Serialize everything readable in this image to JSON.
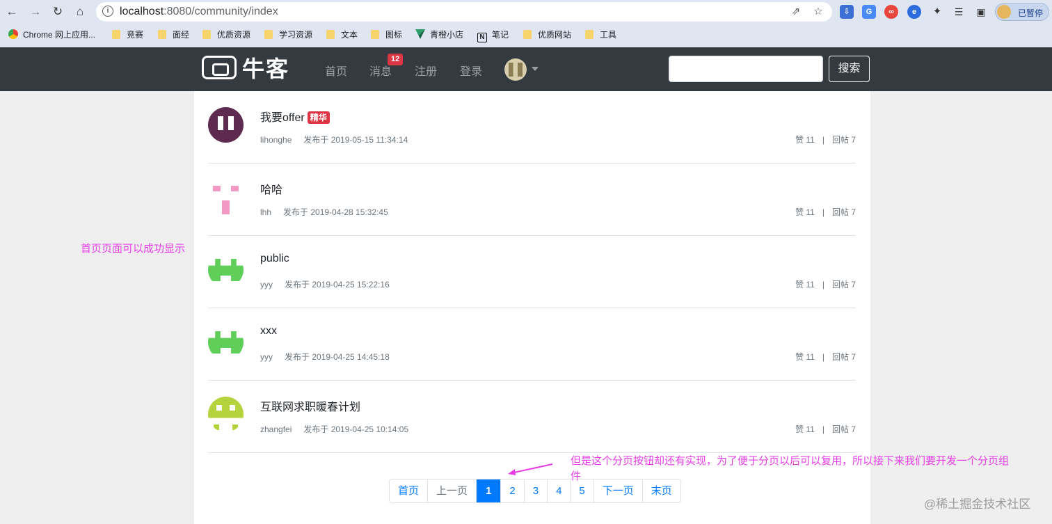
{
  "browser": {
    "url_host": "localhost",
    "url_path": ":8080/community/index",
    "profile_label": "已暂停",
    "bookmarks": [
      {
        "label": "Chrome 网上应用..."
      },
      {
        "label": "竞赛"
      },
      {
        "label": "面经"
      },
      {
        "label": "优质资源"
      },
      {
        "label": "学习资源"
      },
      {
        "label": "文本"
      },
      {
        "label": "图标"
      },
      {
        "label": "青橙小店"
      },
      {
        "label": "笔记"
      },
      {
        "label": "优质网站"
      },
      {
        "label": "工具"
      }
    ]
  },
  "navbar": {
    "logo": "牛客",
    "links": [
      "首页",
      "消息",
      "注册",
      "登录"
    ],
    "message_count": "12",
    "search_button": "搜索",
    "colors": {
      "background": "#343a40",
      "badge": "#dc3545"
    }
  },
  "posts": [
    {
      "title": "我要offer",
      "tag": "精华",
      "author": "lihonghe",
      "time": "发布于 2019-05-15 11:34:14",
      "likes": "赞 11",
      "replies": "回帖 7",
      "avatar_color": "#5e2a4f"
    },
    {
      "title": "哈哈",
      "tag": "",
      "author": "lhh",
      "time": "发布于 2019-04-28 15:32:45",
      "likes": "赞 11",
      "replies": "回帖 7",
      "avatar_color": "#f29ac3"
    },
    {
      "title": "public",
      "tag": "",
      "author": "yyy",
      "time": "发布于 2019-04-25 15:22:16",
      "likes": "赞 11",
      "replies": "回帖 7",
      "avatar_color": "#5fcf5a"
    },
    {
      "title": "xxx",
      "tag": "",
      "author": "yyy",
      "time": "发布于 2019-04-25 14:45:18",
      "likes": "赞 11",
      "replies": "回帖 7",
      "avatar_color": "#5fcf5a"
    },
    {
      "title": "互联网求职暖春计划",
      "tag": "",
      "author": "zhangfei",
      "time": "发布于 2019-04-25 10:14:05",
      "likes": "赞 11",
      "replies": "回帖 7",
      "avatar_color": "#b5d33c"
    }
  ],
  "pagination": {
    "first": "首页",
    "prev": "上一页",
    "pages": [
      "1",
      "2",
      "3",
      "4",
      "5"
    ],
    "active": "1",
    "next": "下一页",
    "last": "末页"
  },
  "annotations": {
    "left_note": "首页页面可以成功显示",
    "bottom_note_line1": "但是这个分页按钮却还有实现，为了便于分页以后可以复用，所以接下来我们要开发一个分页组",
    "bottom_note_line2": "件",
    "watermark": "@稀土掘金技术社区",
    "color": "#e63ce6"
  }
}
